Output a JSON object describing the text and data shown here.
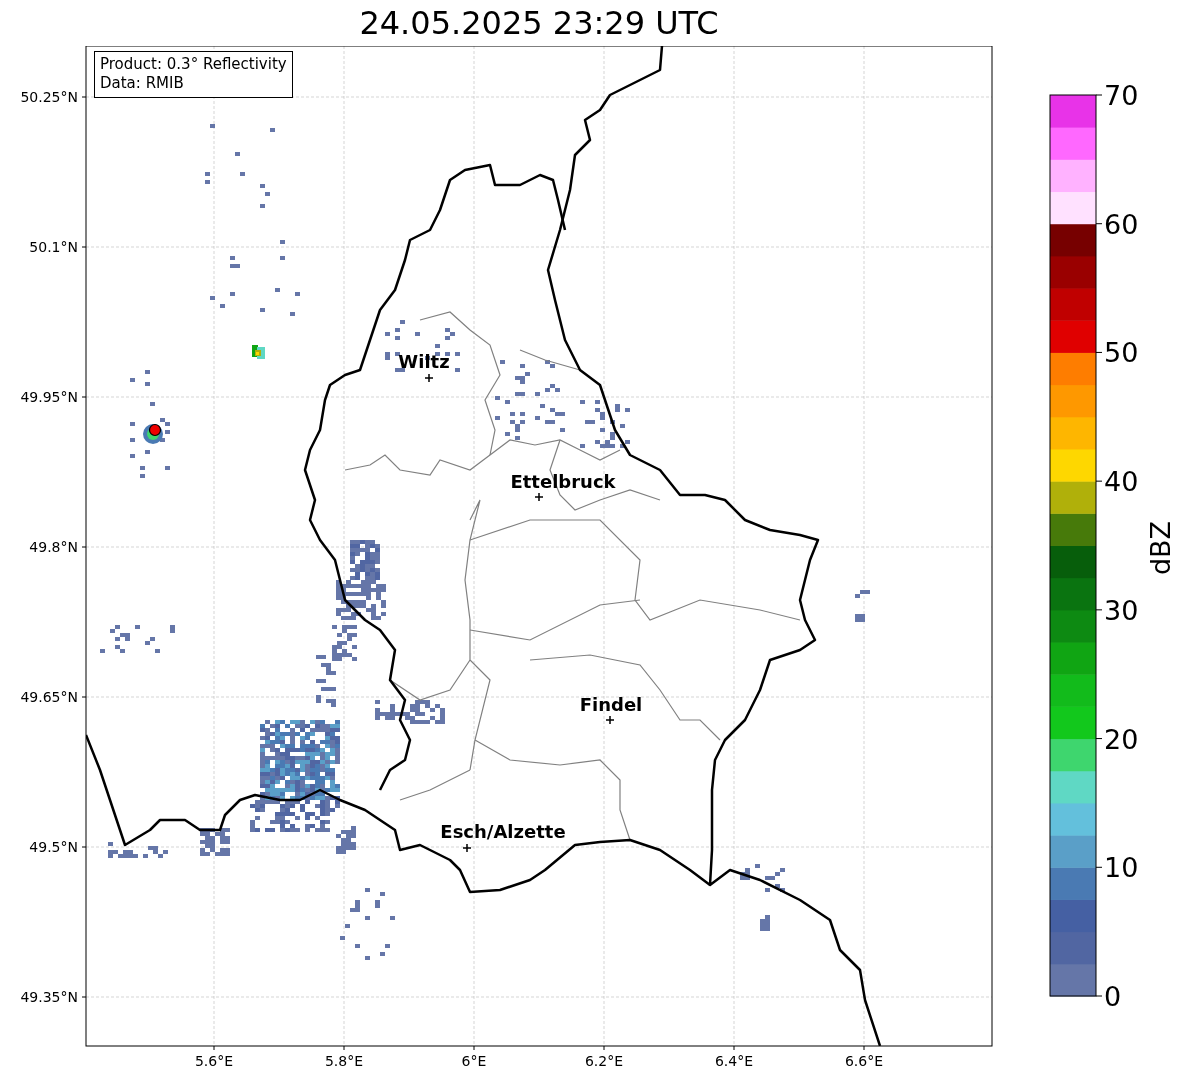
{
  "title": "24.05.2025 23:29 UTC",
  "info_box": [
    "Product: 0.3° Reflectivity",
    "Data: RMIB"
  ],
  "map": {
    "cities": [
      {
        "name": "Wiltz"
      },
      {
        "name": "Ettelbruck"
      },
      {
        "name": "Findel"
      },
      {
        "name": "Esch/Alzette"
      }
    ],
    "x_ticks": [
      "5.6°E",
      "5.8°E",
      "6°E",
      "6.2°E",
      "6.4°E",
      "6.6°E"
    ],
    "y_ticks": [
      "50.25°N",
      "50.1°N",
      "49.95°N",
      "49.8°N",
      "49.65°N",
      "49.5°N",
      "49.35°N"
    ]
  },
  "colorbar": {
    "label": "dBZ",
    "ticks": [
      "70",
      "60",
      "50",
      "40",
      "30",
      "20",
      "10",
      "0"
    ]
  }
}
